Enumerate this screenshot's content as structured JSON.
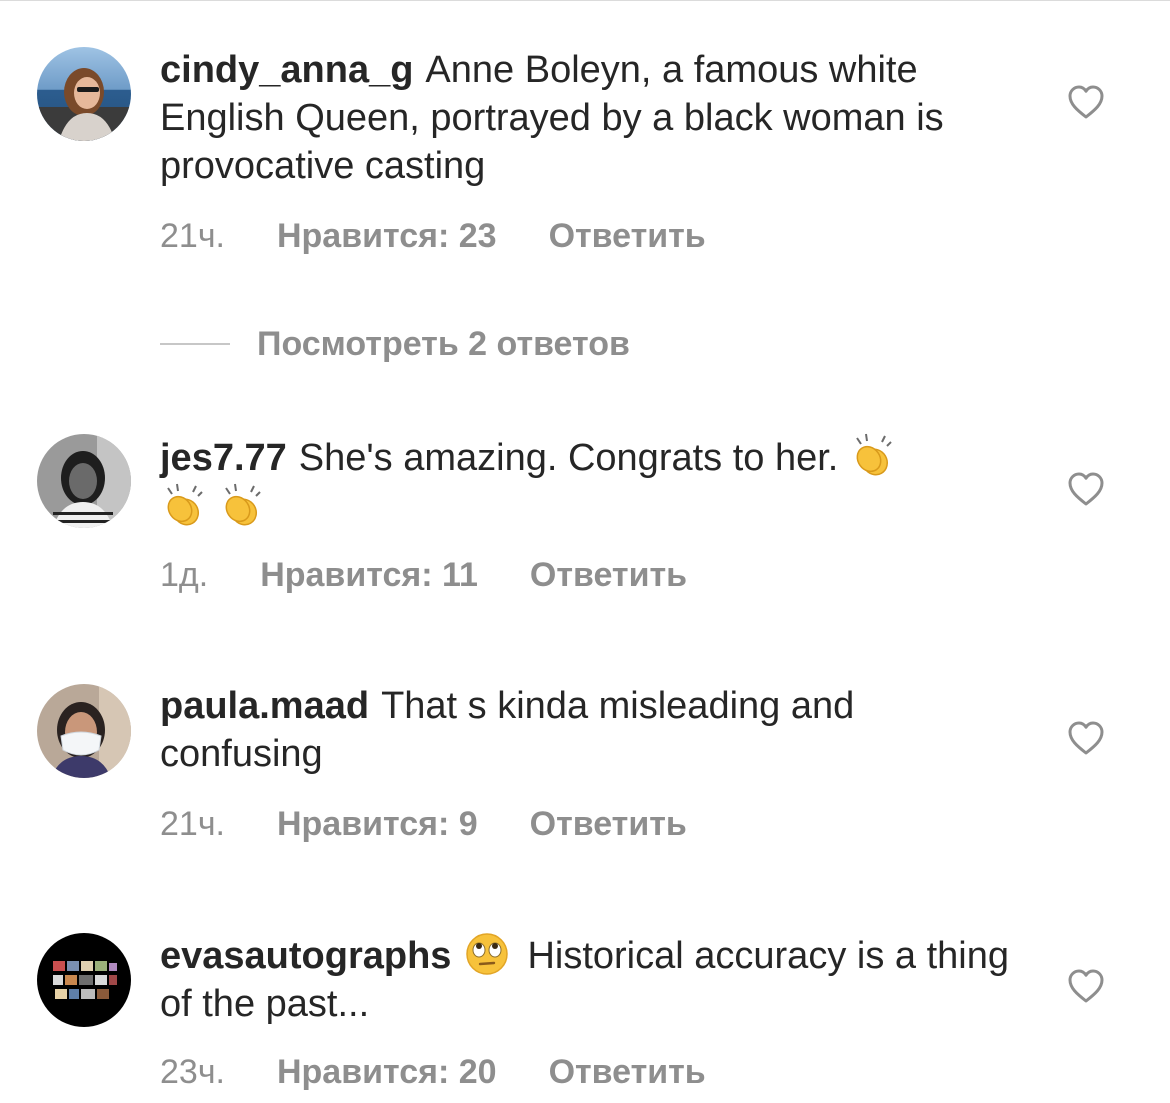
{
  "comments": [
    {
      "username": "cindy_anna_g",
      "text": "Anne Boleyn, a famous white English Queen, portrayed by a black woman is provocative casting",
      "time": "21ч.",
      "likes": "Нравится: 23",
      "reply": "Ответить",
      "avatar": "woman-sunglasses-sea-avatar"
    },
    {
      "username": "jes7.77",
      "text": "She's amazing. Congrats to her.",
      "emojis": [
        "clapping-hands-emoji",
        "clapping-hands-emoji",
        "clapping-hands-emoji"
      ],
      "time": "1д.",
      "likes": "Нравится: 11",
      "reply": "Ответить",
      "avatar": "woman-bw-portrait-avatar"
    },
    {
      "username": "paula.maad",
      "text": "That s kinda misleading and confusing",
      "time": "21ч.",
      "likes": "Нравится: 9",
      "reply": "Ответить",
      "avatar": "woman-face-mask-avatar"
    },
    {
      "username": "evasautographs",
      "text_before_emoji": "",
      "emoji": "face-with-rolling-eyes-emoji",
      "text": "Historical accuracy is a thing of the past...",
      "time": "23ч.",
      "likes": "Нравится: 20",
      "reply": "Ответить",
      "avatar": "photo-collage-avatar"
    }
  ],
  "view_replies": "Посмотреть 2 ответов",
  "icons": {
    "like": "heart-outline-icon"
  },
  "colors": {
    "text": "#262626",
    "secondary": "#8e8e8e",
    "divider": "#dbdbdb"
  }
}
